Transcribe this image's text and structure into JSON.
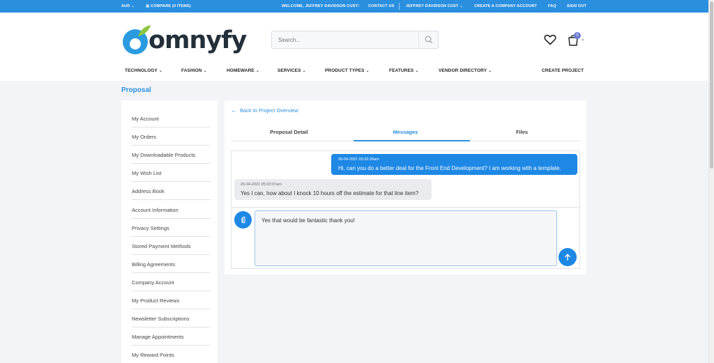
{
  "topbar": {
    "currency": "AUD",
    "compare": "COMPARE (0 ITEMS)",
    "welcome": "WELCOME, JEFFREY DAVIDSON CUST!",
    "contact": "CONTACT US",
    "account": "JEFFREY DAVIDSON CUST",
    "create_company": "CREATE A COMPANY ACCOUNT",
    "faq": "FAQ",
    "sign_out": "SIGN OUT"
  },
  "header": {
    "logo_text": "omnyfy",
    "search_placeholder": "Search...",
    "cart_count": "0"
  },
  "nav": {
    "technology": "TECHNOLOGY",
    "fashion": "FASHION",
    "homeware": "HOMEWARE",
    "services": "SERVICES",
    "product_types": "PRODUCT TYPES",
    "features": "FEATURES",
    "vendor_directory": "VENDOR DIRECTORY",
    "create_project": "CREATE PROJECT"
  },
  "page": {
    "title": "Proposal"
  },
  "sidebar": {
    "items": [
      "My Account",
      "My Orders",
      "My Downloadable Products",
      "My Wish List",
      "Address Book",
      "Account Information",
      "Privacy Settings",
      "Stored Payment Methods",
      "Billing Agreements",
      "Company Account",
      "My Product Reviews",
      "Newsletter Subscriptions",
      "Manage Appointments",
      "My Reward Points"
    ]
  },
  "main": {
    "back_link": "Back to Project Overview",
    "tabs": [
      "Proposal Detail",
      "Messages",
      "Files"
    ],
    "active_tab": "Messages",
    "messages": [
      {
        "timestamp": "26-04-2021 05:32:26am",
        "text": "Hi, can you do a better deal for the Front End Development? I am working with a template.",
        "direction": "outgoing"
      },
      {
        "timestamp": "26-04-2021 05:33:07am",
        "text": "Yes I can, how about I knock 10 hours off the estimate for that line item?",
        "direction": "incoming"
      }
    ],
    "reply_value": "Yes that would be fantastic thank you!"
  },
  "colors": {
    "brand_blue": "#2b8fe0",
    "bubble_blue": "#1e88e5",
    "logo_green": "#8dc63f",
    "logo_blue": "#2b9be0"
  }
}
